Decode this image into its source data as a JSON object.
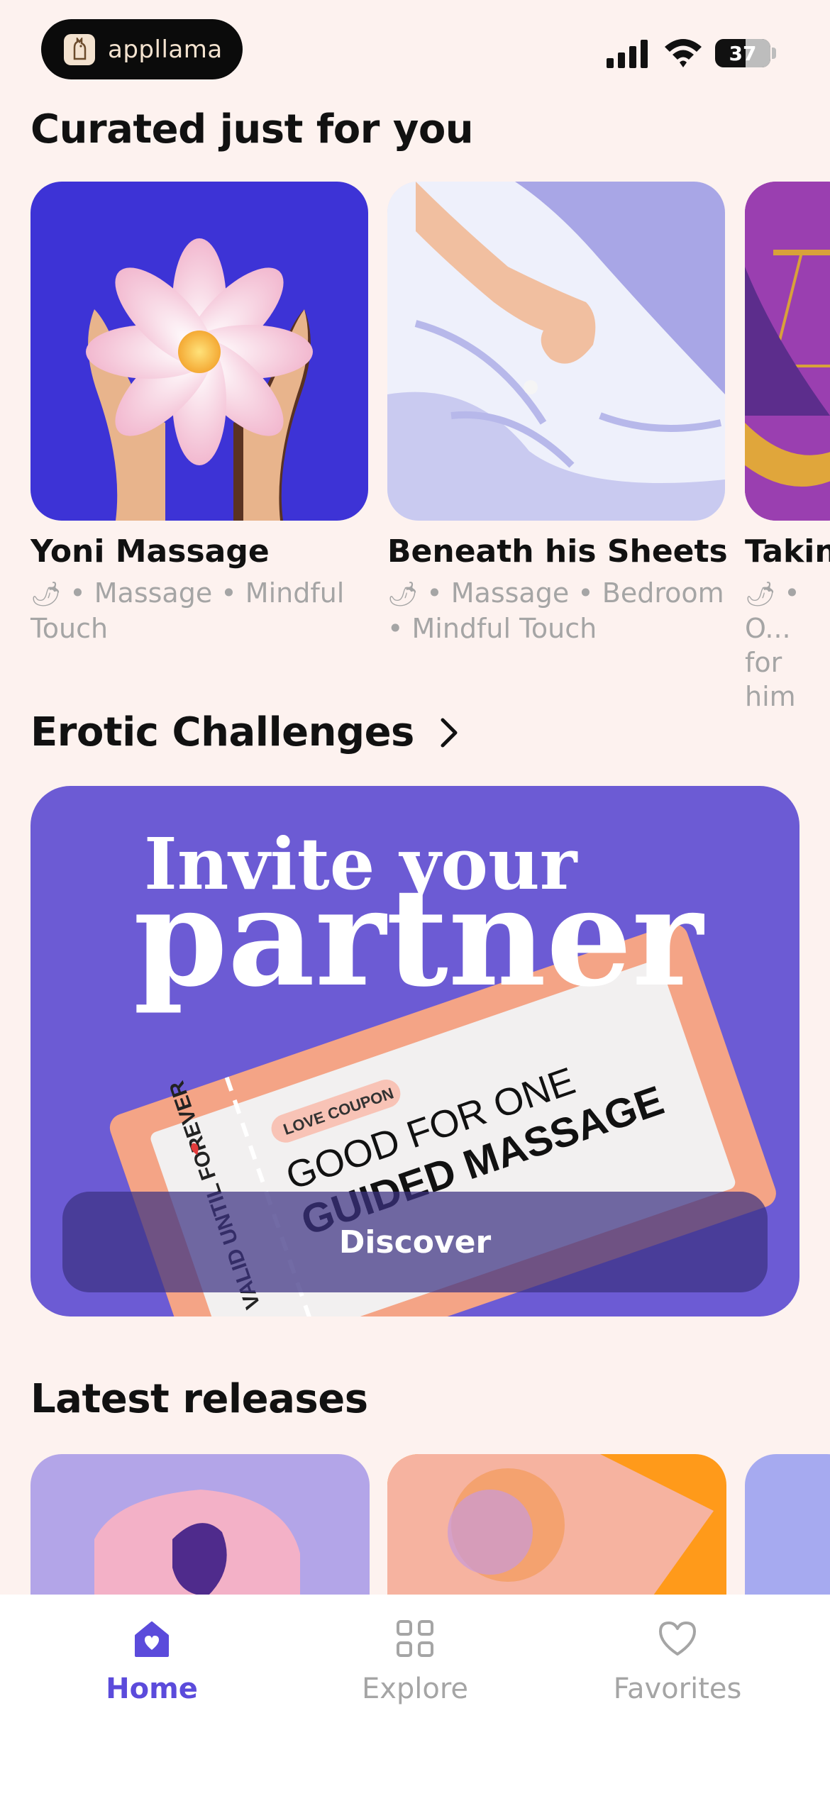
{
  "status_bar": {
    "brand_name": "appllama",
    "battery": "37"
  },
  "curated": {
    "title": "Curated just for you",
    "cards": [
      {
        "title": "Yoni Massage",
        "meta": "• Massage • Mindful Touch"
      },
      {
        "title": "Beneath his Sheets",
        "meta": "• Massage • Bedroom • Mindful Touch"
      },
      {
        "title": "Taking",
        "meta": "• O... for him"
      }
    ]
  },
  "challenges": {
    "title": "Erotic Challenges",
    "banner": {
      "line1": "Invite your",
      "line2": "partner",
      "coupon_tag": "LOVE COUPON",
      "coupon_line1": "GOOD FOR ONE",
      "coupon_line2": "GUIDED MASSAGE",
      "stub_text": "VALID UNTIL FOREVER",
      "button": "Discover"
    }
  },
  "latest": {
    "title": "Latest releases"
  },
  "tabbar": {
    "items": [
      {
        "label": "Home",
        "icon": "home-icon",
        "active": true
      },
      {
        "label": "Explore",
        "icon": "grid-icon",
        "active": false
      },
      {
        "label": "Favorites",
        "icon": "heart-icon",
        "active": false
      }
    ]
  },
  "colors": {
    "background": "#FDF2EF",
    "accent": "#5B4BDB",
    "banner": "#6C5BD4",
    "inactive": "#A5A5A5"
  }
}
